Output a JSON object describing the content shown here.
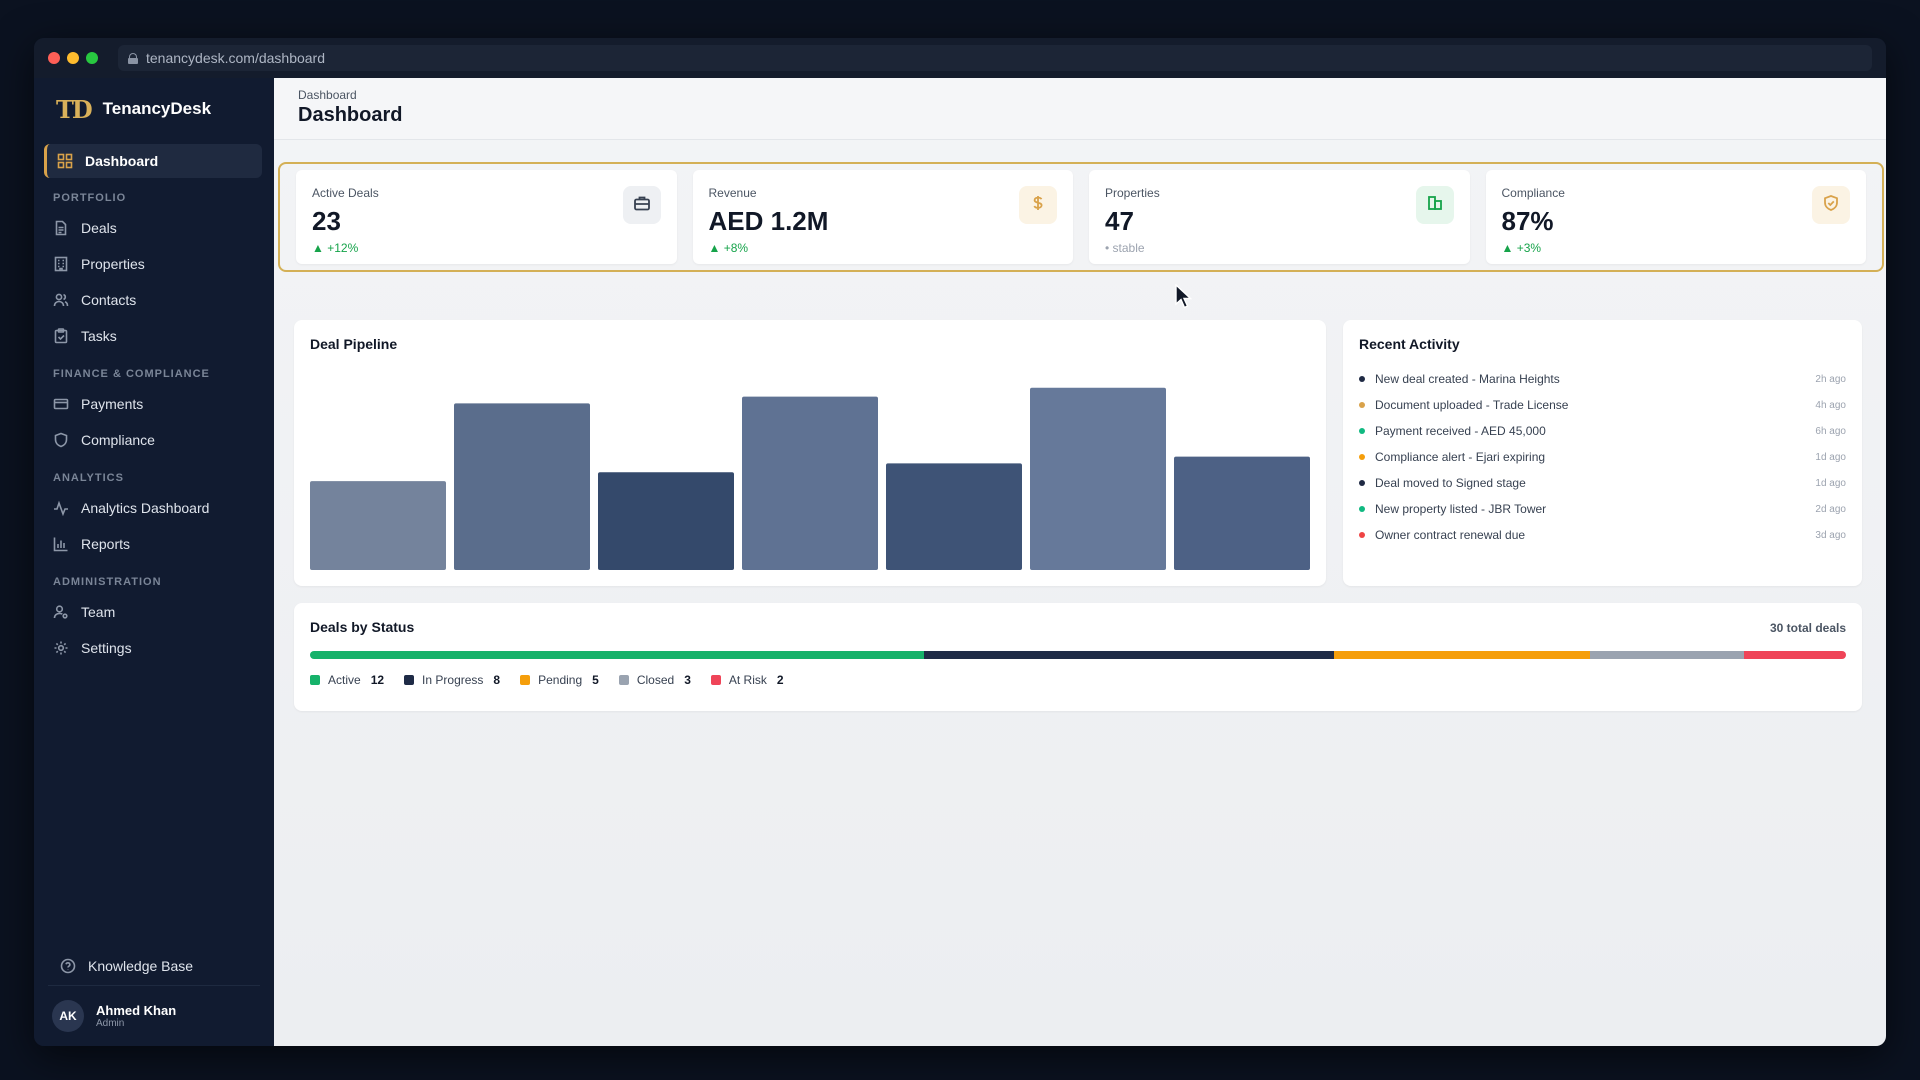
{
  "browser": {
    "url": "tenancydesk.com/dashboard"
  },
  "brand": {
    "logo": "TD",
    "name": "TenancyDesk"
  },
  "sidebar": {
    "active": {
      "label": "Dashboard",
      "icon": "grid-icon"
    },
    "sections": [
      {
        "title": "PORTFOLIO",
        "items": [
          {
            "label": "Deals",
            "icon": "file-icon"
          },
          {
            "label": "Properties",
            "icon": "building-icon"
          },
          {
            "label": "Contacts",
            "icon": "users-icon"
          },
          {
            "label": "Tasks",
            "icon": "clipboard-icon"
          }
        ]
      },
      {
        "title": "FINANCE & COMPLIANCE",
        "items": [
          {
            "label": "Payments",
            "icon": "card-icon"
          },
          {
            "label": "Compliance",
            "icon": "shield-icon"
          }
        ]
      },
      {
        "title": "ANALYTICS",
        "items": [
          {
            "label": "Analytics Dashboard",
            "icon": "activity-icon"
          },
          {
            "label": "Reports",
            "icon": "bar-chart-icon"
          }
        ]
      },
      {
        "title": "ADMINISTRATION",
        "items": [
          {
            "label": "Team",
            "icon": "user-cog-icon"
          },
          {
            "label": "Settings",
            "icon": "gear-icon"
          }
        ]
      }
    ],
    "knowledge_base": "Knowledge Base",
    "user": {
      "initials": "AK",
      "name": "Ahmed Khan",
      "role": "Admin"
    }
  },
  "header": {
    "breadcrumb": "Dashboard",
    "title": "Dashboard"
  },
  "kpis": [
    {
      "label": "Active Deals",
      "value": "23",
      "delta": "▲ +12%",
      "trend": "up",
      "icon": "briefcase-icon",
      "icon_color": "#374151",
      "badge_bg": "#eef0f3"
    },
    {
      "label": "Revenue",
      "value": "AED 1.2M",
      "delta": "▲ +8%",
      "trend": "up",
      "icon": "dollar-icon",
      "icon_color": "#d9a24a",
      "badge_bg": "#fbf3e4"
    },
    {
      "label": "Properties",
      "value": "47",
      "delta": "• stable",
      "trend": "neutral",
      "icon": "building-icon",
      "icon_color": "#16a34a",
      "badge_bg": "#e6f6ec"
    },
    {
      "label": "Compliance",
      "value": "87%",
      "delta": "▲ +3%",
      "trend": "up",
      "icon": "shield-check-icon",
      "icon_color": "#d9a24a",
      "badge_bg": "#fbf3e4"
    }
  ],
  "pipeline": {
    "title": "Deal Pipeline"
  },
  "chart_data": {
    "type": "bar",
    "title": "Deal Pipeline",
    "categories": [],
    "values": [
      4,
      7.5,
      4.4,
      7.8,
      4.8,
      8.2,
      5.1
    ],
    "colors": [
      "#74839c",
      "#5a6d8c",
      "#34496b",
      "#5f7293",
      "#3e5376",
      "#66799a",
      "#4d6185"
    ],
    "ylim": [
      0,
      9
    ],
    "grid": false,
    "note_values": "relative bar heights; no axis labels visible"
  },
  "activity": {
    "title": "Recent Activity",
    "items": [
      {
        "text": "New deal created - Marina Heights",
        "time": "2h ago",
        "color": "#1f2a44"
      },
      {
        "text": "Document uploaded - Trade License",
        "time": "4h ago",
        "color": "#d9a24a"
      },
      {
        "text": "Payment received - AED 45,000",
        "time": "6h ago",
        "color": "#10b981"
      },
      {
        "text": "Compliance alert - Ejari expiring",
        "time": "1d ago",
        "color": "#f59e0b"
      },
      {
        "text": "Deal moved to Signed stage",
        "time": "1d ago",
        "color": "#1f2a44"
      },
      {
        "text": "New property listed - JBR Tower",
        "time": "2d ago",
        "color": "#10b981"
      },
      {
        "text": "Owner contract renewal due",
        "time": "3d ago",
        "color": "#ef4444"
      }
    ]
  },
  "status": {
    "title": "Deals by Status",
    "total": "30 total deals",
    "segments": [
      {
        "label": "Active",
        "count": 12,
        "color": "#16b26a"
      },
      {
        "label": "In Progress",
        "count": 8,
        "color": "#1f2b46"
      },
      {
        "label": "Pending",
        "count": 5,
        "color": "#f59e0b"
      },
      {
        "label": "Closed",
        "count": 3,
        "color": "#9aa3b0"
      },
      {
        "label": "At Risk",
        "count": 2,
        "color": "#ef4458"
      }
    ]
  }
}
